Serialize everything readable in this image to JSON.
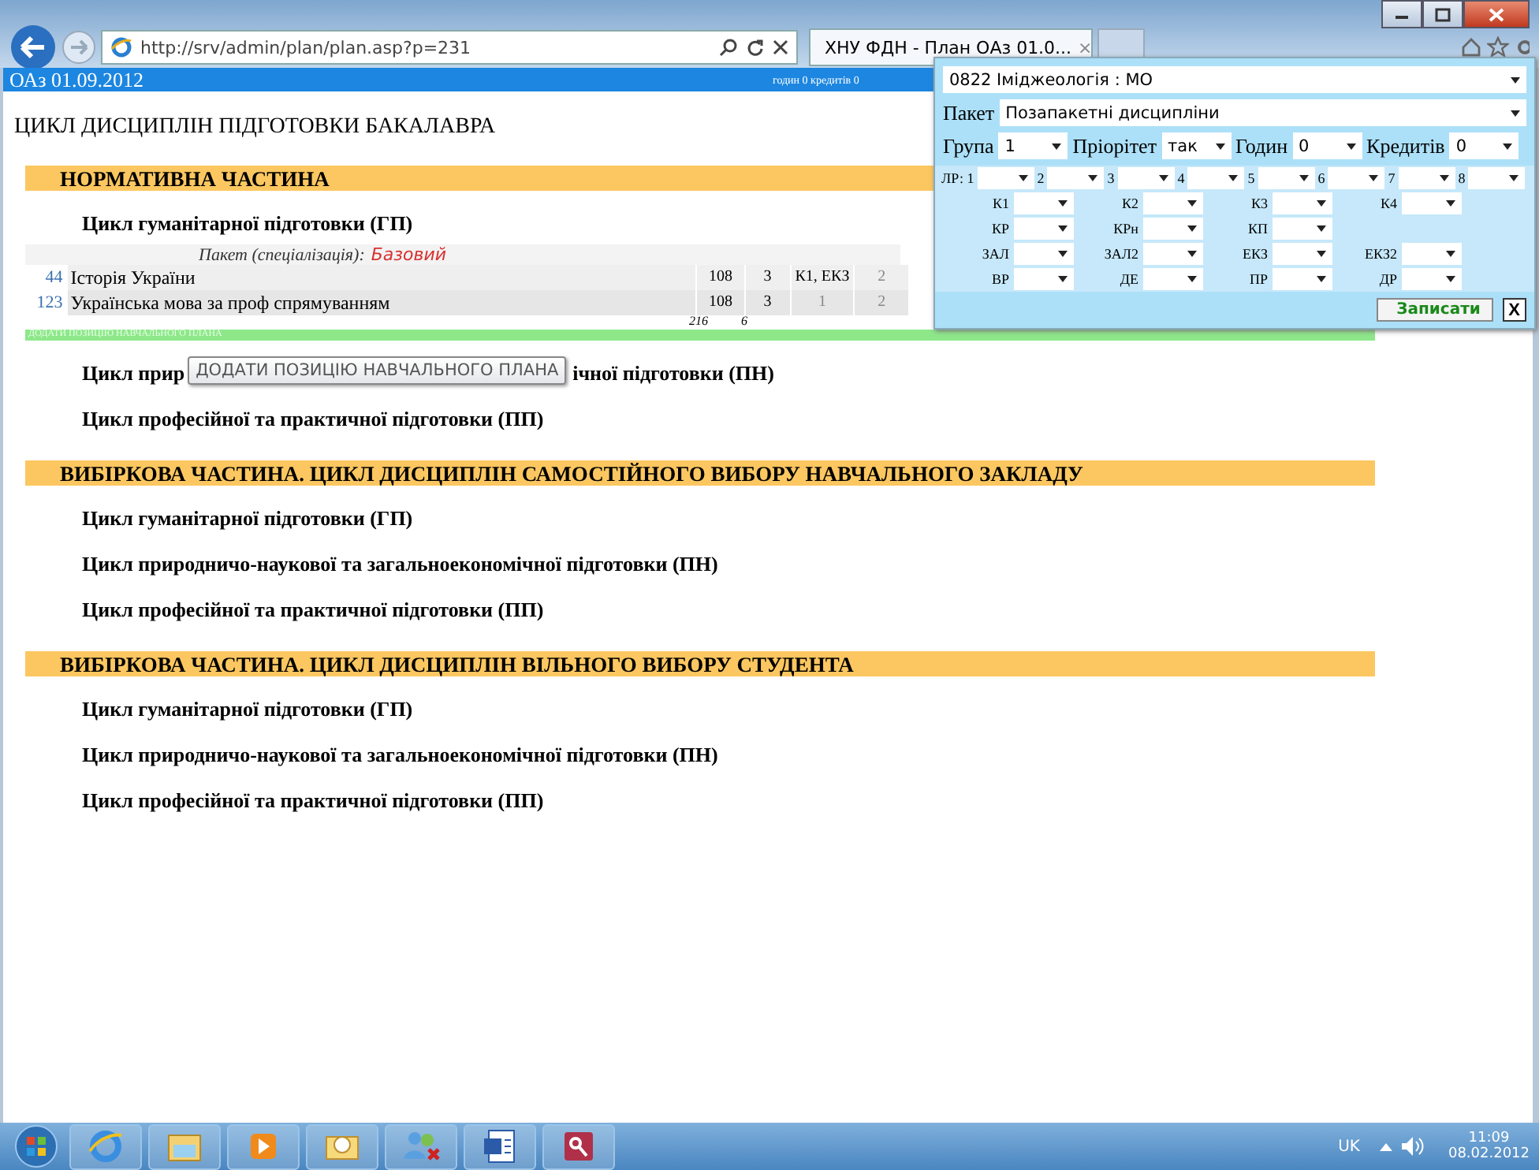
{
  "browser": {
    "url": "http://srv/admin/plan/plan.asp?p=231",
    "tab_title": "ХНУ ФДН - План ОАз 01.0...",
    "tab_close": "×"
  },
  "header": {
    "title": "ОАз 01.09.2012",
    "summary": "годин 0 кредитів 0"
  },
  "page_title": "ЦИКЛ ДИСЦИПЛІН ПІДГОТОВКИ БАКАЛАВРА",
  "sections": [
    {
      "title": "НОРМАТИВНА ЧАСТИНА",
      "cycles": [
        {
          "title": "Цикл гуманітарної підготовки (ГП)",
          "package_label": "Пакет (спеціалізація):",
          "package": "Базовий",
          "rows": [
            {
              "num": "44",
              "name": "Історія України",
              "cells": [
                {
                  "text": "108",
                  "dim": false
                },
                {
                  "text": "3",
                  "dim": false
                },
                {
                  "text": "К1, ЕКЗ",
                  "dim": false
                },
                {
                  "text": "2",
                  "dim": true
                }
              ]
            },
            {
              "num": "123",
              "name": "Українська мова за проф спрямуванням",
              "cells": [
                {
                  "text": "108",
                  "dim": false
                },
                {
                  "text": "3",
                  "dim": false
                },
                {
                  "text": "1",
                  "dim": true
                },
                {
                  "text": "2",
                  "dim": true
                }
              ]
            }
          ],
          "totals": [
            "216",
            "6"
          ],
          "add_label": "ДОДАТИ ПОЗИЦІЮ НАВЧАЛЬНОГО ПЛАНА"
        },
        {
          "title_start": "Цикл прир",
          "title_end": "ічної підготовки (ПН)",
          "tooltip": "ДОДАТИ ПОЗИЦІЮ НАВЧАЛЬНОГО ПЛАНА"
        },
        {
          "title": "Цикл професійної та практичної підготовки (ПП)"
        }
      ]
    },
    {
      "title": "ВИБІРКОВА ЧАСТИНА. ЦИКЛ ДИСЦИПЛІН САМОСТІЙНОГО ВИБОРУ НАВЧАЛЬНОГО ЗАКЛАДУ",
      "cycles": [
        {
          "title": "Цикл гуманітарної підготовки (ГП)"
        },
        {
          "title": "Цикл природничо-наукової та загальноекономічної підготовки (ПН)"
        },
        {
          "title": "Цикл професійної та практичної підготовки (ПП)"
        }
      ]
    },
    {
      "title": "ВИБІРКОВА ЧАСТИНА. ЦИКЛ ДИСЦИПЛІН ВІЛЬНОГО ВИБОРУ СТУДЕНТА",
      "cycles": [
        {
          "title": "Цикл гуманітарної підготовки (ГП)"
        },
        {
          "title": "Цикл природничо-наукової та загальноекономічної підготовки (ПН)"
        },
        {
          "title": "Цикл професійної та практичної підготовки (ПП)"
        }
      ]
    }
  ],
  "popup": {
    "specialty": "0822 Іміджеологія : МО",
    "package_label": "Пакет",
    "package": "Позапакетні дисципліни",
    "fields": [
      {
        "label": "Група",
        "value": "1"
      },
      {
        "label": "Пріорітет",
        "value": "так"
      },
      {
        "label": "Годин",
        "value": "0"
      },
      {
        "label": "Кредитів",
        "value": "0"
      }
    ],
    "lr": [
      "ЛР: 1",
      "2",
      "3",
      "4",
      "5",
      "6",
      "7",
      "8"
    ],
    "grid": [
      [
        "К1",
        "К2",
        "К3",
        "К4"
      ],
      [
        "КР",
        "КРн",
        "КП"
      ],
      [
        "ЗАЛ",
        "ЗАЛ2",
        "ЕКЗ",
        "ЕКЗ2"
      ],
      [
        "ВР",
        "ДЕ",
        "ПР",
        "ДР"
      ]
    ],
    "save": "Записати",
    "close": "X"
  },
  "taskbar": {
    "lang": "UK",
    "time": "11:09",
    "date": "08.02.2012"
  }
}
